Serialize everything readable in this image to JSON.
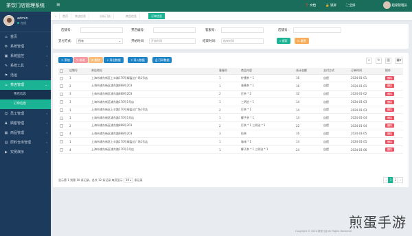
{
  "app": {
    "title": "茶饮门店管理系统",
    "user": "admin",
    "status": "在线"
  },
  "sidebar": {
    "items": [
      {
        "label": "首页",
        "icon": "home-icon",
        "glyph": "⌂"
      },
      {
        "label": "系统管理",
        "icon": "gear-icon",
        "glyph": "⚙"
      },
      {
        "label": "系统监控",
        "icon": "monitor-icon",
        "glyph": "▣"
      },
      {
        "label": "系统工具",
        "icon": "tools-icon",
        "glyph": "✎"
      },
      {
        "label": "活运",
        "icon": "flag-icon",
        "glyph": "⚑"
      },
      {
        "label": "茶店管理",
        "icon": "shop-icon",
        "glyph": "☕"
      }
    ],
    "subitems": [
      {
        "label": "茶店信息"
      },
      {
        "label": "订单信息"
      }
    ],
    "items2": [
      {
        "label": "员工管理",
        "icon": "users-icon",
        "glyph": "☺"
      },
      {
        "label": "顾客管理",
        "icon": "customer-icon",
        "glyph": "♟"
      },
      {
        "label": "商品管理",
        "icon": "goods-icon",
        "glyph": "▦"
      },
      {
        "label": "原料仓库管理",
        "icon": "warehouse-icon",
        "glyph": "▤"
      },
      {
        "label": "实例演示",
        "icon": "demo-icon",
        "glyph": "▶"
      }
    ]
  },
  "topbar": {
    "doc": "文档",
    "lock": "锁屏",
    "full": "全屏",
    "user": "超级管理员"
  },
  "tabs": [
    "首页",
    "茶店信息",
    "分析门店",
    "商品信息",
    "订单信息"
  ],
  "filter": {
    "labels": {
      "shop": "店铺号:",
      "addr": "茶店编号:",
      "phone": "客服号:",
      "orderno": "店铺号:",
      "pay": "支付方式:",
      "start": "开始时间:",
      "end": "结束时间:"
    },
    "pay_value": "所有",
    "start_placeholder": "开始时间",
    "end_placeholder": "结束时间",
    "search": "搜索",
    "reset": "重置"
  },
  "toolbar": {
    "add": "添加",
    "edit": "修改",
    "del": "删除",
    "import": "导出数据",
    "export": "导入数据",
    "print": "打印数据"
  },
  "table": {
    "headers": [
      "",
      "店铺号",
      "茶店地址",
      "客服号",
      "商品内容",
      "合计金额",
      "支付方式",
      "订单时间",
      "操作"
    ],
    "del_label": "删除",
    "rows": [
      [
        "1",
        "上海市浦东新区上丰路170号绿盈达广场1号店",
        "1",
        "柠檬茶 * 1",
        "16",
        "自提",
        "2024-01-01"
      ],
      [
        "2",
        "上海市浦东新区浦东路888号203",
        "1",
        "香蕉茶 * 1",
        "16",
        "自提",
        "2024-01-01"
      ],
      [
        "3",
        "上海市浦东新区浦东路888号203",
        "2",
        "打茶 * 2",
        "32",
        "自提",
        "2024-01-02"
      ],
      [
        "1",
        "上海市浦东新区浦东路170号1号店",
        "1",
        "三明治 * 1",
        "14",
        "自提",
        "2024-01-03"
      ],
      [
        "1",
        "上海市浦东新区上丰路170号绿盈达广场1号店",
        "2",
        "打茶 * 1",
        "14",
        "自提",
        "2024-01-03"
      ],
      [
        "1",
        "上海市浦东新区浦东路170号1号店",
        "1",
        "椰子茶 * 1",
        "14",
        "自提",
        "2024-01-04"
      ],
      [
        "2",
        "上海市浦东新区浦东路888号203",
        "2",
        "打茶 * 1 三明治 * 1",
        "22",
        "自提",
        "2024-01-04"
      ],
      [
        "4",
        "上海市浦东新区浦东路888号203",
        "3",
        "拉茶",
        "16",
        "自提",
        "2024-01-05"
      ],
      [
        "1",
        "上海市浦东新区上丰路170号绿盈达广场1号店",
        "1",
        "咖啡 * 1",
        "14",
        "自提",
        "2024-01-05"
      ],
      [
        "4",
        "上海市浦东新区浦东路170号1号店",
        "1",
        "椰子茶 * 1 三明治 * 1",
        "24",
        "自提",
        "2024-01-06"
      ]
    ]
  },
  "footer": {
    "info": "显示第 1 到第 10 条记录，总共 12 条记录 每页显示",
    "per_page": "10",
    "unit": "条记录"
  },
  "pager": [
    "‹",
    "1",
    "2",
    "›"
  ],
  "copyright": "Copyright © 2024 茶饮门店 All Rights Reserved",
  "watermark": "煎蛋手游"
}
